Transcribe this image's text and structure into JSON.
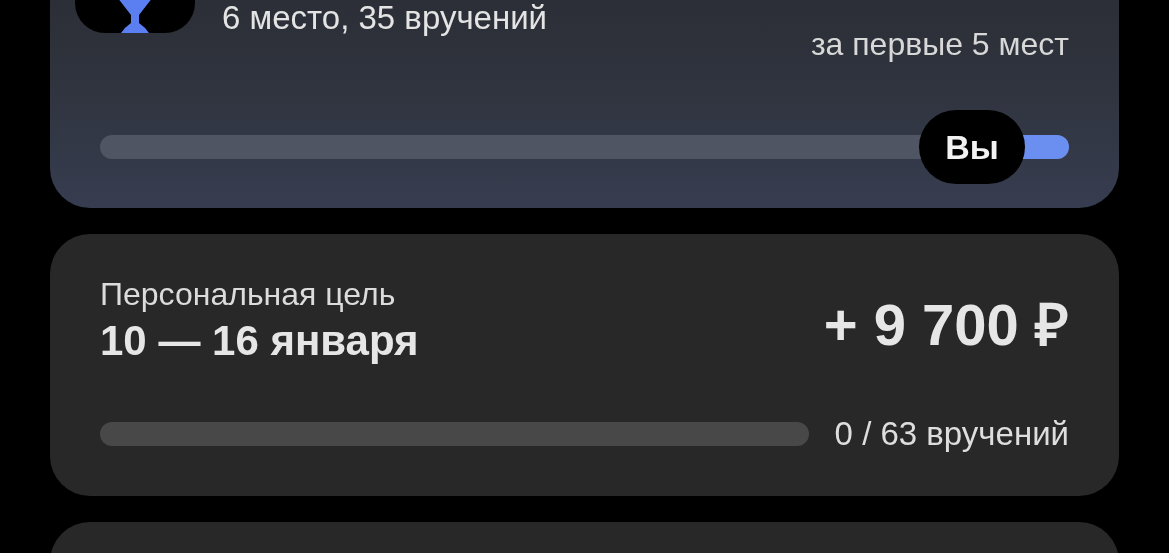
{
  "rating_card": {
    "subtitle": "6 место, 35 вручений",
    "reward_note": "за первые 5 мест",
    "progress": {
      "marker_label": "Вы",
      "level": 0.9
    }
  },
  "goal_card": {
    "label": "Персональная цель",
    "period": "10 — 16 января",
    "reward": "+ 9 700 ₽",
    "progress": {
      "level": 0,
      "reading": "0 / 63 вручений"
    }
  }
}
